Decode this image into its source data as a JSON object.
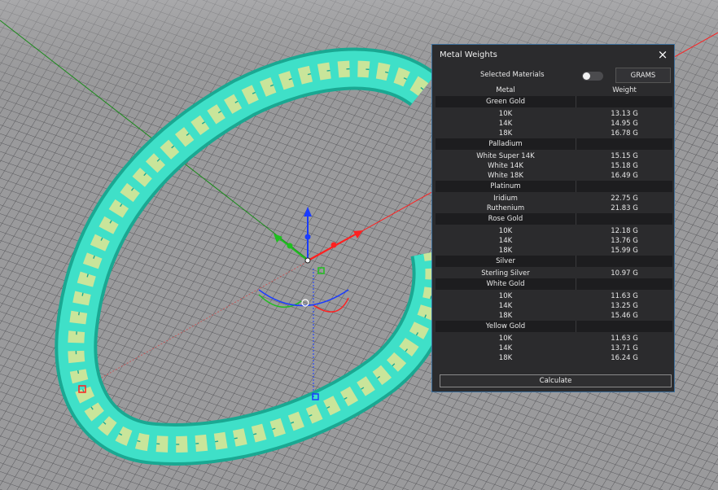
{
  "panel": {
    "title": "Metal Weights",
    "close_icon": "×",
    "selected_materials_label": "Selected Materials",
    "units_button": "GRAMS",
    "col_metal": "Metal",
    "col_weight": "Weight",
    "groups": [
      {
        "name": "Green Gold",
        "rows": [
          [
            "10K",
            "13.13 G"
          ],
          [
            "14K",
            "14.95 G"
          ],
          [
            "18K",
            "16.78 G"
          ]
        ]
      },
      {
        "name": "Palladium",
        "rows": [
          [
            "White Super 14K",
            "15.15 G"
          ],
          [
            "White 14K",
            "15.18 G"
          ],
          [
            "White 18K",
            "16.49 G"
          ]
        ]
      },
      {
        "name": "Platinum",
        "rows": [
          [
            "Iridium",
            "22.75 G"
          ],
          [
            "Ruthenium",
            "21.83 G"
          ]
        ]
      },
      {
        "name": "Rose Gold",
        "rows": [
          [
            "10K",
            "12.18 G"
          ],
          [
            "14K",
            "13.76 G"
          ],
          [
            "18K",
            "15.99 G"
          ]
        ]
      },
      {
        "name": "Silver",
        "rows": [
          [
            "Sterling Silver",
            "10.97 G"
          ]
        ]
      },
      {
        "name": "White Gold",
        "rows": [
          [
            "10K",
            "11.63 G"
          ],
          [
            "14K",
            "13.25 G"
          ],
          [
            "18K",
            "15.46 G"
          ]
        ]
      },
      {
        "name": "Yellow Gold",
        "rows": [
          [
            "10K",
            "11.63 G"
          ],
          [
            "14K",
            "13.71 G"
          ],
          [
            "18K",
            "16.24 G"
          ]
        ]
      }
    ],
    "calculate_button": "Calculate"
  },
  "colors": {
    "ring": "#3fe0c8",
    "axis_x": "#ff2020",
    "axis_y": "#1a8a1a",
    "axis_z": "#1a3cff"
  }
}
